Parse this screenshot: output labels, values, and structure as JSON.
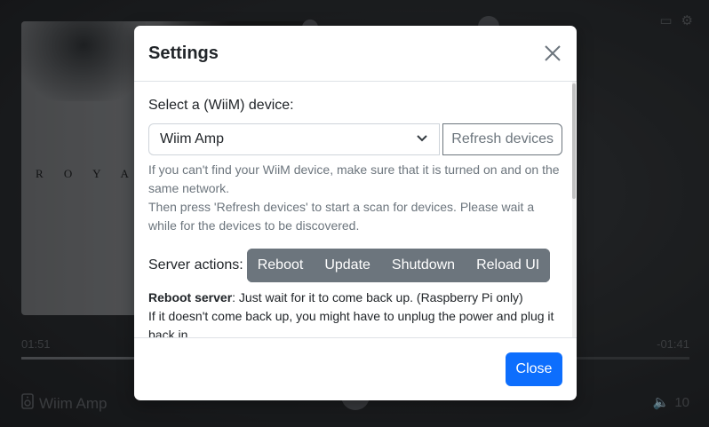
{
  "player": {
    "album_text": "R O Y A L",
    "time_elapsed": "01:51",
    "time_remaining": "-01:41",
    "progress_fraction": 0.43,
    "device_name": "Wiim Amp",
    "volume": "10"
  },
  "modal": {
    "title": "Settings",
    "device_label": "Select a (WiiM) device:",
    "selected_device": "Wiim Amp",
    "refresh_label": "Refresh devices",
    "help_line1": "If you can't find your WiiM device, make sure that it is turned on and on the same network.",
    "help_line2": "Then press 'Refresh devices' to start a scan for devices. Please wait a while for the devices to be discovered.",
    "server_actions_label": "Server actions:",
    "actions": [
      "Reboot",
      "Update",
      "Shutdown",
      "Reload UI"
    ],
    "reboot_title": "Reboot server",
    "reboot_desc": ": Just wait for it to come back up. (Raspberry Pi only)",
    "reboot_extra": "If it doesn't come back up, you might have to unplug the power and plug it back in.",
    "close_label": "Close"
  },
  "colors": {
    "primary": "#0d6efd",
    "secondary": "#6c757d",
    "backdrop": "#2a2d31"
  }
}
